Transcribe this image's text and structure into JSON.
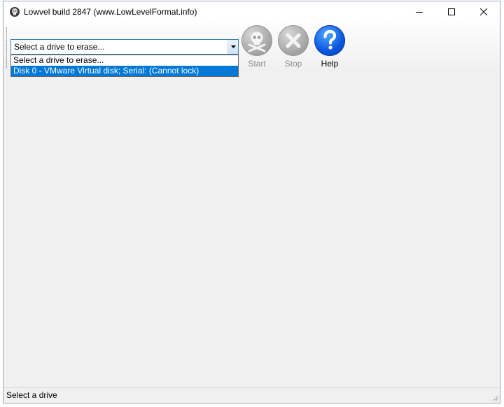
{
  "window": {
    "title": "Lowvel build 2847 (www.LowLevelFormat.info)"
  },
  "drive_select": {
    "value": "Select a drive to erase...",
    "options": [
      "Select a drive to erase...",
      "Disk 0 - VMware Virtual disk; Serial:  (Cannot lock)"
    ],
    "highlighted_index": 1
  },
  "toolbar": {
    "start_label": "Start",
    "stop_label": "Stop",
    "help_label": "Help"
  },
  "status": {
    "text": "Select a drive"
  },
  "colors": {
    "highlight": "#0078d7",
    "help_button": "#0a55e0",
    "disabled_button": "#a8a8a8"
  },
  "icons": {
    "app": "lowvel-skull-icon",
    "start": "skull-crossbones-icon",
    "stop": "x-icon",
    "help": "question-mark-icon"
  }
}
